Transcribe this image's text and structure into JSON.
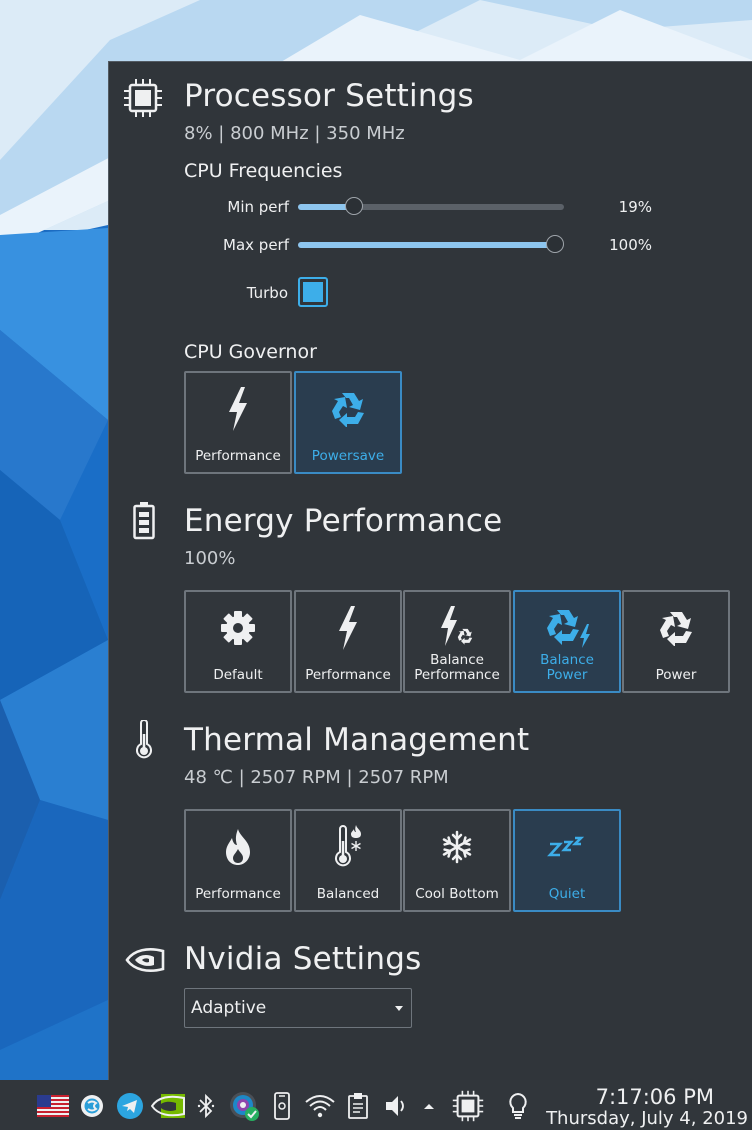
{
  "processor": {
    "title": "Processor Settings",
    "subtitle": "8% | 800 MHz | 350 MHz",
    "frequencies_label": "CPU Frequencies",
    "min_perf": {
      "label": "Min perf",
      "value": 19,
      "display": "19%"
    },
    "max_perf": {
      "label": "Max perf",
      "value": 100,
      "display": "100%"
    },
    "turbo": {
      "label": "Turbo",
      "checked": true
    },
    "governor_label": "CPU Governor",
    "governor_options": [
      {
        "label": "Performance",
        "icon": "lightning-icon",
        "active": false
      },
      {
        "label": "Powersave",
        "icon": "recycle-icon",
        "active": true
      }
    ]
  },
  "energy": {
    "title": "Energy Performance",
    "subtitle": "100%",
    "options": [
      {
        "label": "Default",
        "icon": "gear-icon",
        "active": false
      },
      {
        "label": "Performance",
        "icon": "lightning-icon",
        "active": false
      },
      {
        "label": "Balance Performance",
        "icon": "lightning-recycle-icon",
        "active": false
      },
      {
        "label": "Balance Power",
        "icon": "recycle-lightning-icon",
        "active": true
      },
      {
        "label": "Power",
        "icon": "recycle-icon",
        "active": false
      }
    ]
  },
  "thermal": {
    "title": "Thermal Management",
    "subtitle": "48 ℃ | 2507 RPM | 2507 RPM",
    "options": [
      {
        "label": "Performance",
        "icon": "flame-icon",
        "active": false
      },
      {
        "label": "Balanced",
        "icon": "thermometer-flame-snow-icon",
        "active": false
      },
      {
        "label": "Cool Bottom",
        "icon": "snowflake-icon",
        "active": false
      },
      {
        "label": "Quiet",
        "icon": "sleep-icon",
        "active": true
      }
    ]
  },
  "nvidia": {
    "title": "Nvidia Settings",
    "selected": "Adaptive"
  },
  "taskbar": {
    "time": "7:17:06 PM",
    "date": "Thursday, July 4, 2019"
  },
  "colors": {
    "accent": "#3daee9",
    "panel": "#30353a",
    "taskbar": "#31363b"
  }
}
